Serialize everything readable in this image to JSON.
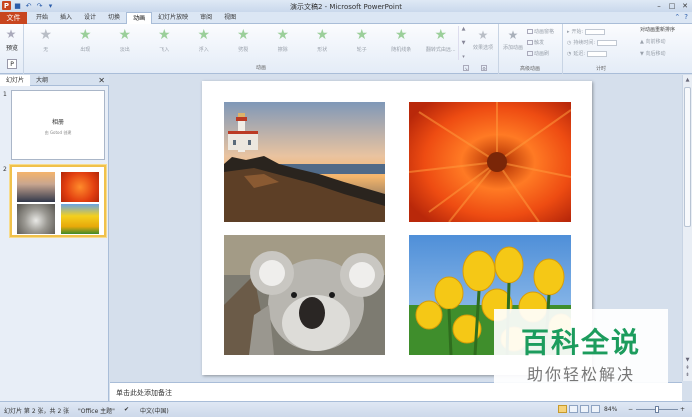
{
  "window": {
    "title": "演示文稿2 - Microsoft PowerPoint"
  },
  "ribbon_tabs": {
    "file": "文件",
    "tabs": [
      "开始",
      "插入",
      "设计",
      "切换",
      "动画",
      "幻灯片放映",
      "审阅",
      "视图"
    ],
    "active_index": 4
  },
  "ribbon": {
    "preview_label": "预览",
    "animations": [
      "无",
      "出现",
      "淡出",
      "飞入",
      "浮入",
      "劈裂",
      "擦除",
      "形状",
      "轮子",
      "随机线条",
      "翻转式由远..."
    ],
    "effect_options": "效果选项",
    "animation_group_label": "动画",
    "add_animation": "添加动画",
    "advanced": {
      "pane": "动画窗格",
      "trigger": "触发",
      "painter": "动画刷"
    },
    "advanced_group_label": "高级动画",
    "timing": {
      "start": "开始:",
      "duration": "持续时间:",
      "delay": "延迟:"
    },
    "timing_group_label": "计时",
    "reorder": {
      "title": "对动画重新排序",
      "earlier": "向前移动",
      "later": "向后移动"
    }
  },
  "left_pane": {
    "tabs": [
      "幻灯片",
      "大纲"
    ],
    "active_tab": 0,
    "slides": [
      {
        "number": "1",
        "title": "相册",
        "subtitle": "由 Gotod 创建"
      },
      {
        "number": "2"
      }
    ]
  },
  "notes": {
    "placeholder": "单击此处添加备注"
  },
  "status": {
    "slide_info": "幻灯片 第 2 张，共 2 张",
    "theme": "\"Office 主题\"",
    "language": "中文(中国)",
    "zoom": "84%"
  },
  "watermark": {
    "title": "百科全说",
    "subtitle": "助你轻松解决"
  },
  "colors": {
    "file_tab": "#c8451f",
    "selection": "#f0c14b",
    "watermark_green": "#1c9c5d"
  }
}
